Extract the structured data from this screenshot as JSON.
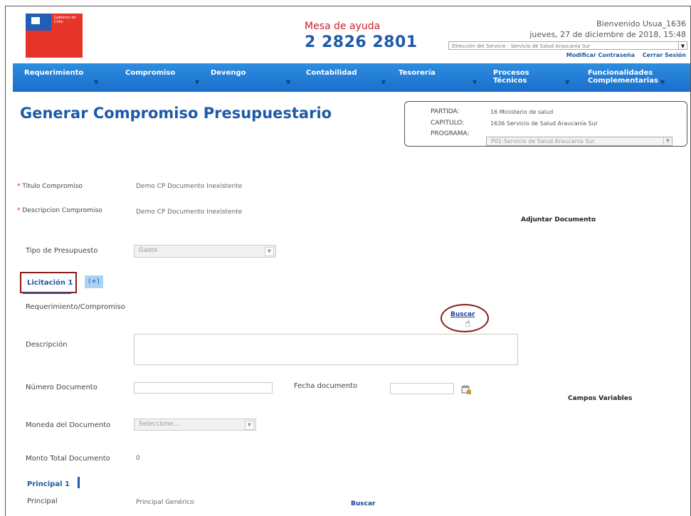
{
  "header": {
    "help_title": "Mesa de ayuda",
    "help_phone": "2 2826 2801",
    "welcome": "Bienvenido Usua_1636",
    "date": "jueves, 27 de diciembre de 2018, 15:48",
    "dept_select_value": "Dirección del Servicio - Servicio de Salud Araucanía Sur",
    "modify_password": "Modificar Contraseña",
    "logout": "Cerrar Sesión",
    "logo_text": "Gobierno de Chile"
  },
  "nav": {
    "items": [
      {
        "label": "Requerimiento"
      },
      {
        "label": "Compromiso"
      },
      {
        "label": "Devengo"
      },
      {
        "label": "Contabilidad"
      },
      {
        "label": "Tesorería"
      },
      {
        "label": "Procesos Técnicos"
      },
      {
        "label": "Funcionalidades Complementarias"
      }
    ]
  },
  "page": {
    "title": "Generar Compromiso Presupuestario"
  },
  "info": {
    "partida_label": "PARTIDA:",
    "partida_value": "16 Ministerio de salud",
    "capitulo_label": "CAPITULO:",
    "capitulo_value": "1636 Servicio de Salud Araucanía Sur",
    "programa_label": "PROGRAMA:",
    "programa_value": "P01-Servicio de Salud Araucania Sur"
  },
  "form": {
    "titulo_label": "Titulo Compromiso",
    "titulo_value": "Demo CP Documento Inexistente",
    "descripcion_label": "Descripcion Compromiso",
    "descripcion_value": "Demo CP Documento Inexistente",
    "adjuntar": "Adjuntar Documento",
    "tipo_label": "Tipo de Presupuesto",
    "tipo_value": "Gasto",
    "licitacion_tab": "Licitación 1",
    "add_tab": "(+)",
    "req_comp_label": "Requerimiento/Compromiso",
    "buscar": "Buscar",
    "descripcion2_label": "Descripción",
    "num_doc_label": "Número Documento",
    "fecha_doc_label": "Fecha documento",
    "campos_variables": "Campos Variables",
    "moneda_label": "Moneda del Documento",
    "moneda_value": "Seleccione...",
    "monto_label": "Monto Total Documento",
    "monto_value": "0",
    "principal_tab": "Principal 1",
    "principal_label": "Principal",
    "principal_value": "Principal Genérico",
    "buscar2": "Buscar"
  },
  "colors": {
    "nav_blue": "#1a6ecb",
    "title_blue": "#1e5aa8",
    "highlight_red": "#8b1a1a",
    "required_red": "#d0202a"
  }
}
